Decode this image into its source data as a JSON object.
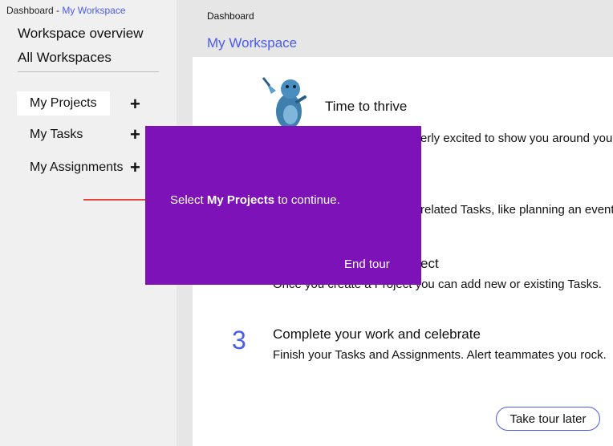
{
  "sidebar": {
    "breadcrumb_root": "Dashboard - ",
    "breadcrumb_current": "My Workspace",
    "links": [
      "Workspace overview",
      "All Workspaces"
    ],
    "items": [
      {
        "label": "My Projects",
        "action": "+"
      },
      {
        "label": "My Tasks",
        "action": "+"
      },
      {
        "label": "My Assignments",
        "action": "+"
      }
    ]
  },
  "main": {
    "breadcrumb": "Dashboard",
    "title": "My Workspace",
    "card": {
      "heading": "Time to thrive",
      "intro": "erly excited to show you around your",
      "step2_fragment": "related Tasks, like planning an event",
      "step2_title_fragment": "ect",
      "step2_desc": "Once you create a Project you can add new or existing Tasks.",
      "step3_number": "3",
      "step3_title": "Complete your work and celebrate",
      "step3_desc": "Finish your Tasks and Assignments. Alert teammates you rock.",
      "tour_later_label": "Take tour later"
    }
  },
  "tour": {
    "message_prefix": "Select ",
    "message_bold": "My Projects",
    "message_suffix": " to continue.",
    "end_label": "End tour"
  },
  "colors": {
    "accent": "#4a5cf0",
    "overlay": "#7d12b8",
    "pointer": "#e0453b",
    "sidebar_bg": "#f0f0f0",
    "main_bg": "#e6e6e6"
  },
  "icons": {
    "mascot": "otter-mascot-icon",
    "pointer": "arrow-right-icon",
    "add": "plus-icon"
  }
}
